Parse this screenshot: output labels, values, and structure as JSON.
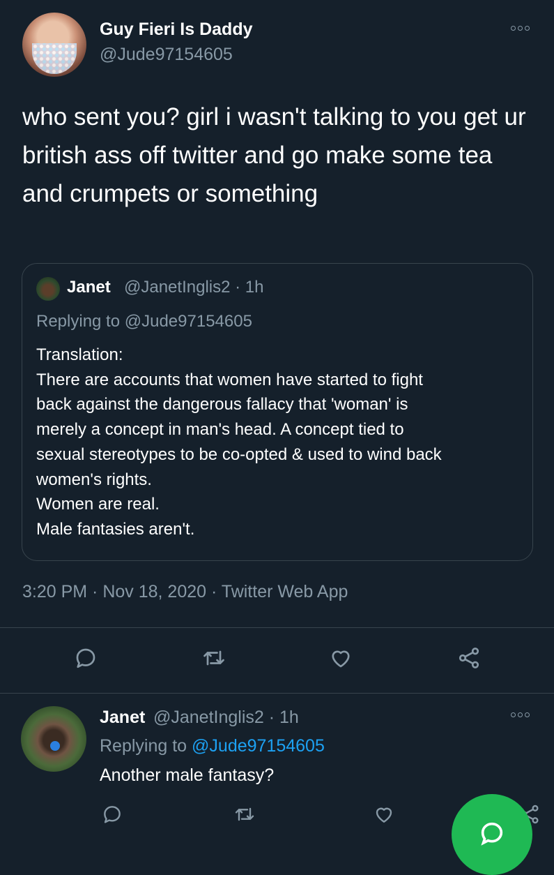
{
  "tweet": {
    "author_name": "Guy Fieri Is Daddy",
    "author_handle": "@Jude97154605",
    "text": "who sent you? girl i wasn't talking to you get ur british ass off twitter and go make some tea and crumpets or something",
    "timestamp": "3:20 PM · Nov 18, 2020 · Twitter Web App"
  },
  "quoted": {
    "author_name": "Janet",
    "meta": "@JanetInglis2 · 1h",
    "replying_to": "Replying to @Jude97154605",
    "lines": [
      "Translation:",
      "There are accounts that women have started to fight",
      "back against the dangerous fallacy that 'woman' is",
      "merely a concept in man's head. A concept tied to",
      "sexual stereotypes to be co-opted & used to wind back",
      "women's rights.",
      "Women are real.",
      "Male fantasies aren't."
    ]
  },
  "reply": {
    "author_name": "Janet",
    "meta": "@JanetInglis2 · 1h",
    "replying_prefix": "Replying to ",
    "replying_handle": "@Jude97154605",
    "text": "Another male fantasy?"
  },
  "icons": {
    "reply": "reply-icon",
    "retweet": "retweet-icon",
    "like": "like-icon",
    "share": "share-icon",
    "more": "more-icon",
    "compose": "compose-icon"
  },
  "colors": {
    "background": "#15202b",
    "secondary_text": "#8899a6",
    "border": "#38444d",
    "link": "#1da1f2",
    "fab": "#1fb954"
  }
}
